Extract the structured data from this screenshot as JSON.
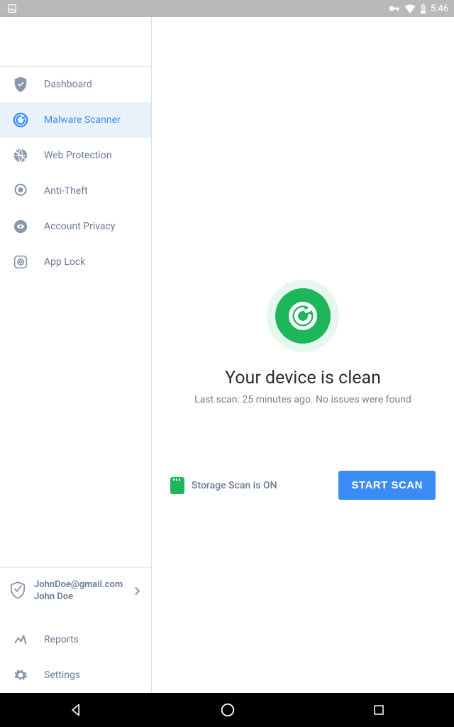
{
  "status_bar": {
    "time": "5:46"
  },
  "sidebar": {
    "items": [
      {
        "label": "Dashboard"
      },
      {
        "label": "Malware Scanner"
      },
      {
        "label": "Web Protection"
      },
      {
        "label": "Anti-Theft"
      },
      {
        "label": "Account Privacy"
      },
      {
        "label": "App Lock"
      }
    ],
    "account": {
      "email": "JohnDoe@gmail.com",
      "name": "John Doe"
    },
    "bottom_items": [
      {
        "label": "Reports"
      },
      {
        "label": "Settings"
      }
    ]
  },
  "main": {
    "title": "Your device is clean",
    "subtitle": "Last scan: 25 minutes ago. No issues were found",
    "storage_label": "Storage Scan is ON",
    "scan_button": "START SCAN"
  }
}
